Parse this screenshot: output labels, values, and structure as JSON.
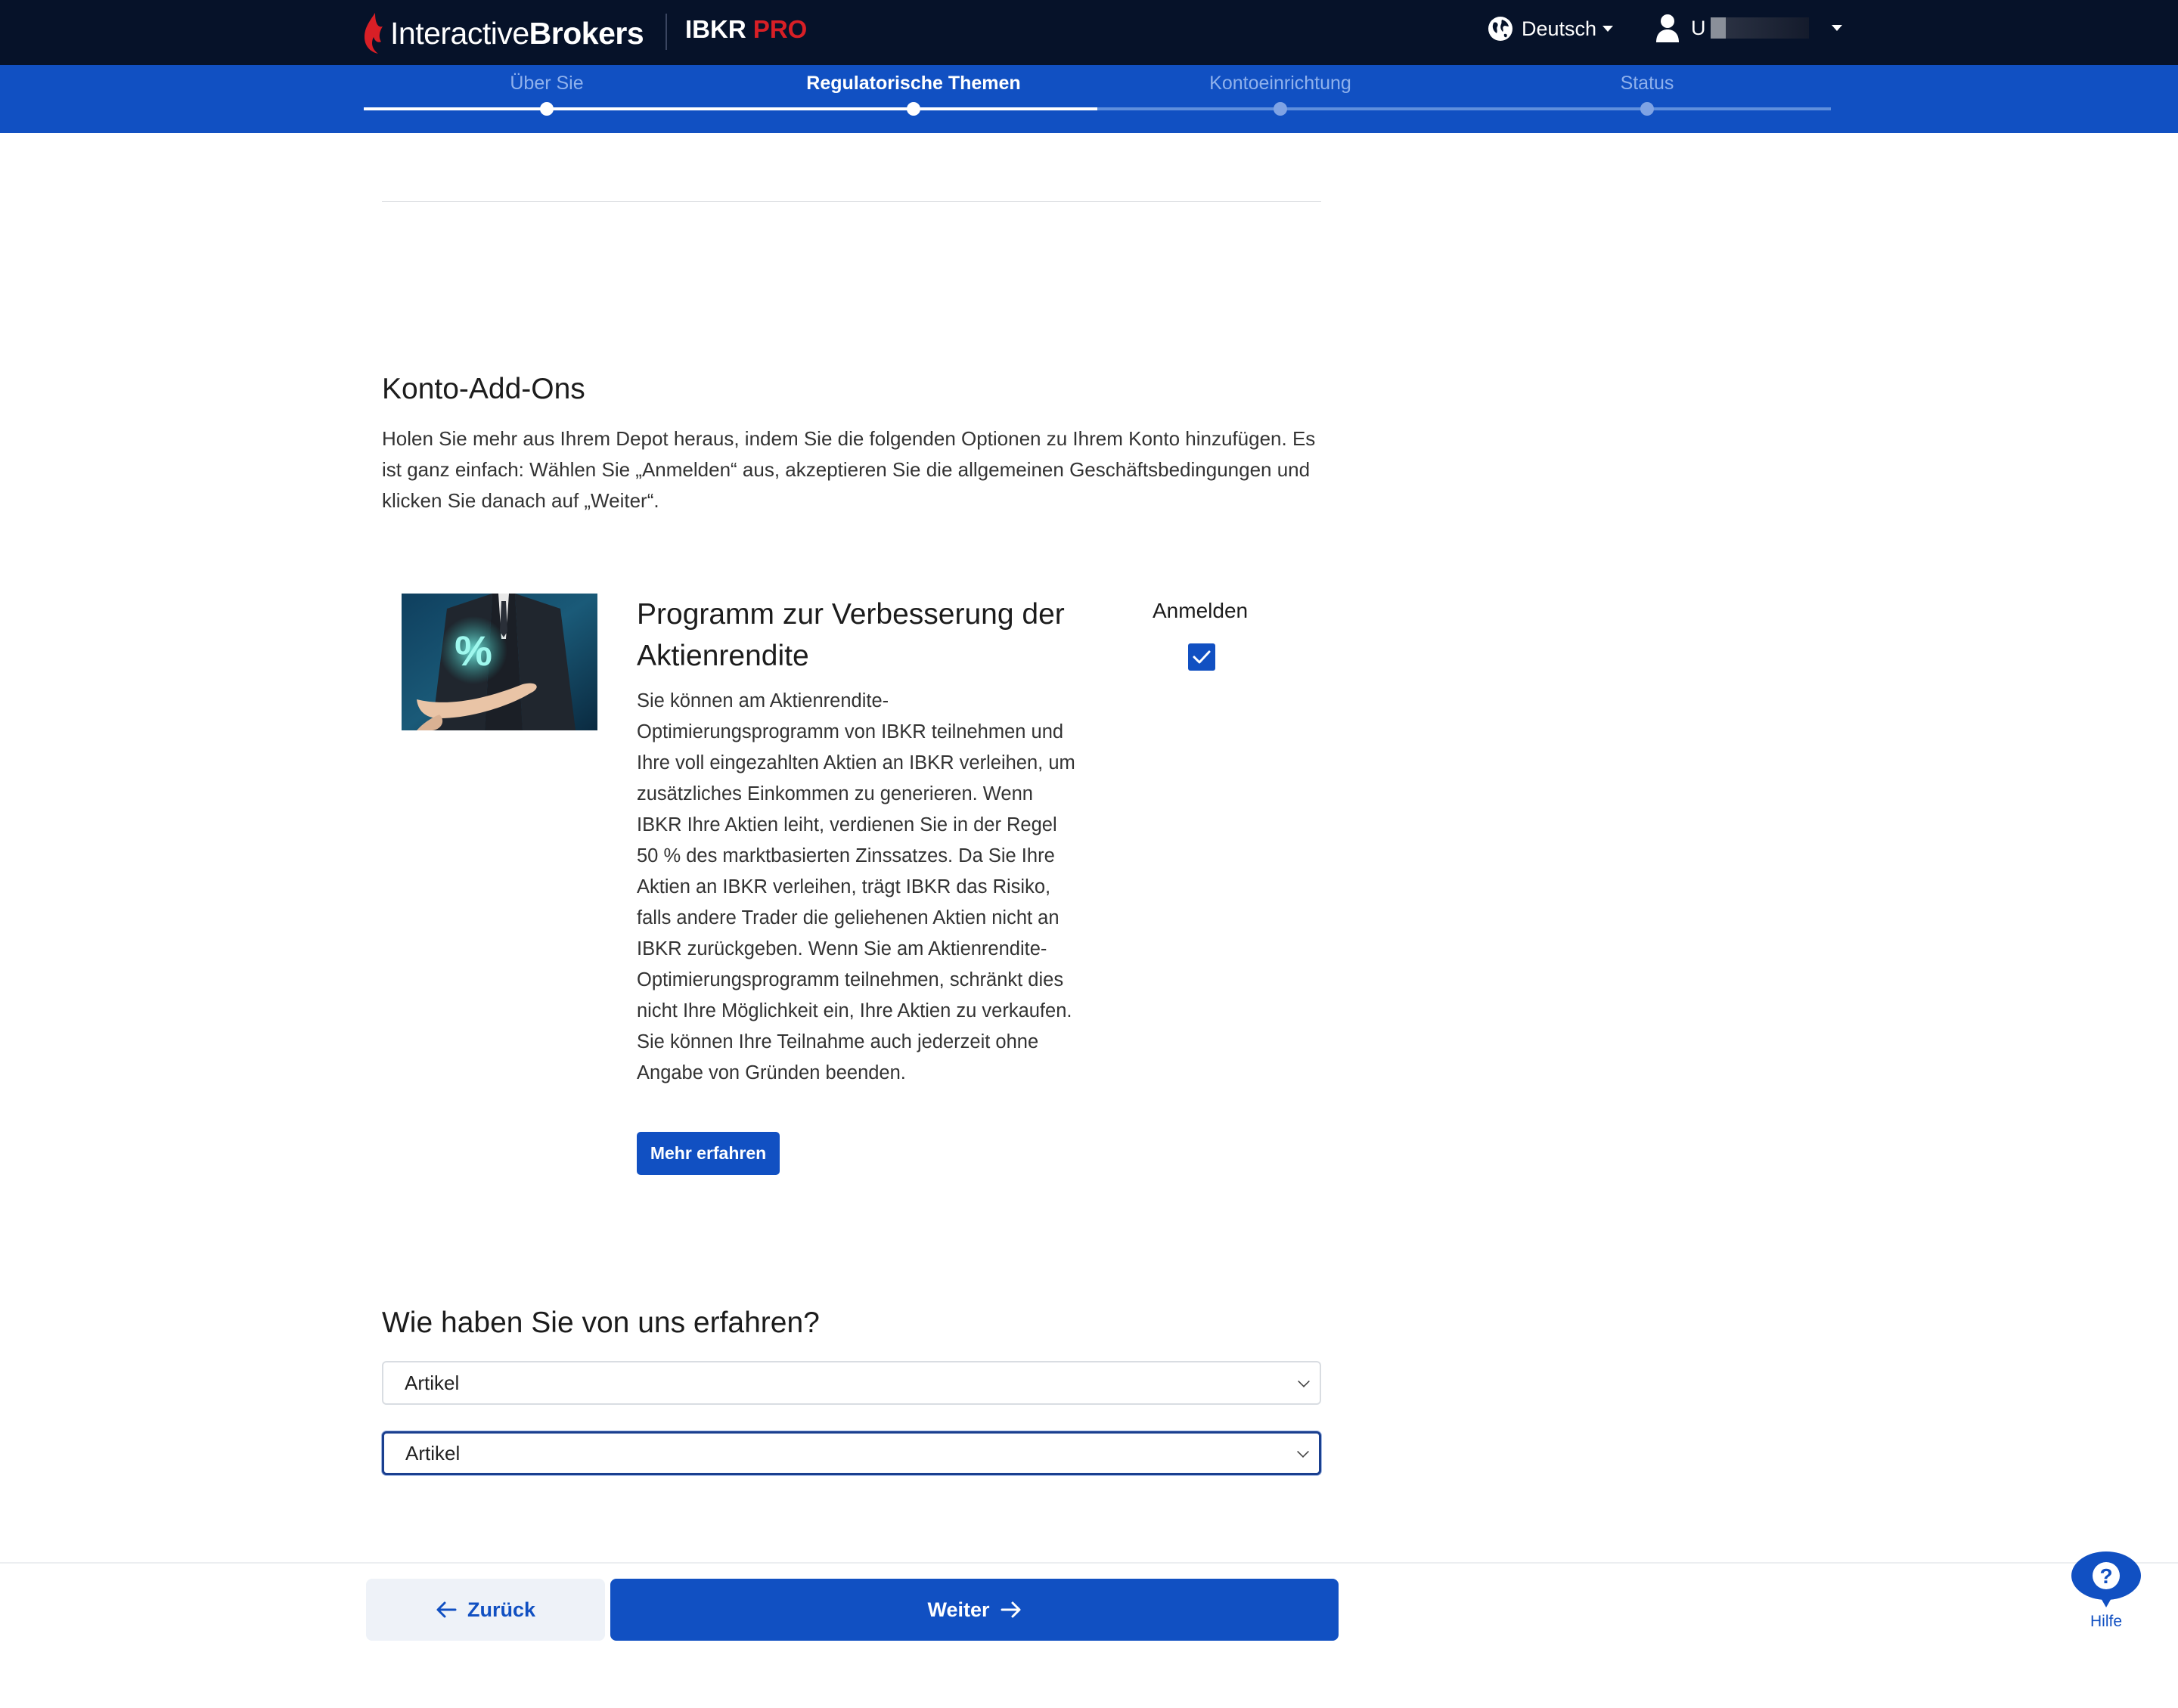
{
  "header": {
    "logo_light": "Interactive",
    "logo_bold": "Brokers",
    "product": "IBKR",
    "product_accent": "PRO",
    "language": "Deutsch",
    "user": "U",
    "colors": {
      "bar": "#061229",
      "accent_red": "#d81f26"
    }
  },
  "steps": {
    "items": [
      {
        "label": "Über Sie",
        "state": "done"
      },
      {
        "label": "Regulatorische Themen",
        "state": "active"
      },
      {
        "label": "Kontoeinrichtung",
        "state": "pending"
      },
      {
        "label": "Status",
        "state": "pending"
      }
    ],
    "color": "#1150c2"
  },
  "addons": {
    "title": "Konto-Add-Ons",
    "intro": "Holen Sie mehr aus Ihrem Depot heraus, indem Sie die folgenden Optionen zu Ihrem Konto hinzufügen. Es ist ganz einfach: Wählen Sie „Anmelden“ aus, akzeptieren Sie die allgemeinen Geschäftsbedingungen und klicken Sie danach auf „Weiter“.",
    "program": {
      "image_icon": "percent-hand-image",
      "image_glyph": "%",
      "title": "Programm zur Verbesserung der Aktienrendite",
      "description": "Sie können am Aktienrendite-Optimierungsprogramm von IBKR teilnehmen und Ihre voll eingezahlten Aktien an IBKR verleihen, um zusätzliches Einkommen zu generieren. Wenn IBKR Ihre Aktien leiht, verdienen Sie in der Regel 50 % des marktbasierten Zinssatzes. Da Sie Ihre Aktien an IBKR verleihen, trägt IBKR das Risiko, falls andere Trader die geliehenen Aktien nicht an IBKR zurückgeben. Wenn Sie am Aktienrendite-Optimierungsprogramm teilnehmen, schränkt dies nicht Ihre Möglichkeit ein, Ihre Aktien zu verkaufen. Sie können Ihre Teilnahme auch jederzeit ohne Angabe von Gründen beenden.",
      "more_label": "Mehr erfahren",
      "enroll_label": "Anmelden",
      "enrolled": true
    }
  },
  "referral": {
    "title": "Wie haben Sie von uns erfahren?",
    "select1_value": "Artikel",
    "select2_value": "Artikel"
  },
  "footer": {
    "back_label": "Zurück",
    "next_label": "Weiter",
    "help_label": "Hilfe",
    "help_glyph": "?"
  }
}
